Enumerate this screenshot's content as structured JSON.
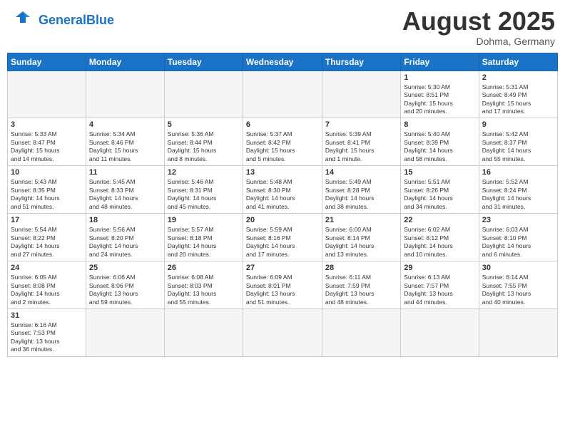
{
  "header": {
    "logo_general": "General",
    "logo_blue": "Blue",
    "month_title": "August 2025",
    "subtitle": "Dohma, Germany"
  },
  "weekdays": [
    "Sunday",
    "Monday",
    "Tuesday",
    "Wednesday",
    "Thursday",
    "Friday",
    "Saturday"
  ],
  "weeks": [
    [
      {
        "day": "",
        "empty": true
      },
      {
        "day": "",
        "empty": true
      },
      {
        "day": "",
        "empty": true
      },
      {
        "day": "",
        "empty": true
      },
      {
        "day": "",
        "empty": true
      },
      {
        "day": "1",
        "lines": [
          "Sunrise: 5:30 AM",
          "Sunset: 8:51 PM",
          "Daylight: 15 hours",
          "and 20 minutes."
        ]
      },
      {
        "day": "2",
        "lines": [
          "Sunrise: 5:31 AM",
          "Sunset: 8:49 PM",
          "Daylight: 15 hours",
          "and 17 minutes."
        ]
      }
    ],
    [
      {
        "day": "3",
        "lines": [
          "Sunrise: 5:33 AM",
          "Sunset: 8:47 PM",
          "Daylight: 15 hours",
          "and 14 minutes."
        ]
      },
      {
        "day": "4",
        "lines": [
          "Sunrise: 5:34 AM",
          "Sunset: 8:46 PM",
          "Daylight: 15 hours",
          "and 11 minutes."
        ]
      },
      {
        "day": "5",
        "lines": [
          "Sunrise: 5:36 AM",
          "Sunset: 8:44 PM",
          "Daylight: 15 hours",
          "and 8 minutes."
        ]
      },
      {
        "day": "6",
        "lines": [
          "Sunrise: 5:37 AM",
          "Sunset: 8:42 PM",
          "Daylight: 15 hours",
          "and 5 minutes."
        ]
      },
      {
        "day": "7",
        "lines": [
          "Sunrise: 5:39 AM",
          "Sunset: 8:41 PM",
          "Daylight: 15 hours",
          "and 1 minute."
        ]
      },
      {
        "day": "8",
        "lines": [
          "Sunrise: 5:40 AM",
          "Sunset: 8:39 PM",
          "Daylight: 14 hours",
          "and 58 minutes."
        ]
      },
      {
        "day": "9",
        "lines": [
          "Sunrise: 5:42 AM",
          "Sunset: 8:37 PM",
          "Daylight: 14 hours",
          "and 55 minutes."
        ]
      }
    ],
    [
      {
        "day": "10",
        "lines": [
          "Sunrise: 5:43 AM",
          "Sunset: 8:35 PM",
          "Daylight: 14 hours",
          "and 51 minutes."
        ]
      },
      {
        "day": "11",
        "lines": [
          "Sunrise: 5:45 AM",
          "Sunset: 8:33 PM",
          "Daylight: 14 hours",
          "and 48 minutes."
        ]
      },
      {
        "day": "12",
        "lines": [
          "Sunrise: 5:46 AM",
          "Sunset: 8:31 PM",
          "Daylight: 14 hours",
          "and 45 minutes."
        ]
      },
      {
        "day": "13",
        "lines": [
          "Sunrise: 5:48 AM",
          "Sunset: 8:30 PM",
          "Daylight: 14 hours",
          "and 41 minutes."
        ]
      },
      {
        "day": "14",
        "lines": [
          "Sunrise: 5:49 AM",
          "Sunset: 8:28 PM",
          "Daylight: 14 hours",
          "and 38 minutes."
        ]
      },
      {
        "day": "15",
        "lines": [
          "Sunrise: 5:51 AM",
          "Sunset: 8:26 PM",
          "Daylight: 14 hours",
          "and 34 minutes."
        ]
      },
      {
        "day": "16",
        "lines": [
          "Sunrise: 5:52 AM",
          "Sunset: 8:24 PM",
          "Daylight: 14 hours",
          "and 31 minutes."
        ]
      }
    ],
    [
      {
        "day": "17",
        "lines": [
          "Sunrise: 5:54 AM",
          "Sunset: 8:22 PM",
          "Daylight: 14 hours",
          "and 27 minutes."
        ]
      },
      {
        "day": "18",
        "lines": [
          "Sunrise: 5:56 AM",
          "Sunset: 8:20 PM",
          "Daylight: 14 hours",
          "and 24 minutes."
        ]
      },
      {
        "day": "19",
        "lines": [
          "Sunrise: 5:57 AM",
          "Sunset: 8:18 PM",
          "Daylight: 14 hours",
          "and 20 minutes."
        ]
      },
      {
        "day": "20",
        "lines": [
          "Sunrise: 5:59 AM",
          "Sunset: 8:16 PM",
          "Daylight: 14 hours",
          "and 17 minutes."
        ]
      },
      {
        "day": "21",
        "lines": [
          "Sunrise: 6:00 AM",
          "Sunset: 8:14 PM",
          "Daylight: 14 hours",
          "and 13 minutes."
        ]
      },
      {
        "day": "22",
        "lines": [
          "Sunrise: 6:02 AM",
          "Sunset: 8:12 PM",
          "Daylight: 14 hours",
          "and 10 minutes."
        ]
      },
      {
        "day": "23",
        "lines": [
          "Sunrise: 6:03 AM",
          "Sunset: 8:10 PM",
          "Daylight: 14 hours",
          "and 6 minutes."
        ]
      }
    ],
    [
      {
        "day": "24",
        "lines": [
          "Sunrise: 6:05 AM",
          "Sunset: 8:08 PM",
          "Daylight: 14 hours",
          "and 2 minutes."
        ]
      },
      {
        "day": "25",
        "lines": [
          "Sunrise: 6:06 AM",
          "Sunset: 8:06 PM",
          "Daylight: 13 hours",
          "and 59 minutes."
        ]
      },
      {
        "day": "26",
        "lines": [
          "Sunrise: 6:08 AM",
          "Sunset: 8:03 PM",
          "Daylight: 13 hours",
          "and 55 minutes."
        ]
      },
      {
        "day": "27",
        "lines": [
          "Sunrise: 6:09 AM",
          "Sunset: 8:01 PM",
          "Daylight: 13 hours",
          "and 51 minutes."
        ]
      },
      {
        "day": "28",
        "lines": [
          "Sunrise: 6:11 AM",
          "Sunset: 7:59 PM",
          "Daylight: 13 hours",
          "and 48 minutes."
        ]
      },
      {
        "day": "29",
        "lines": [
          "Sunrise: 6:13 AM",
          "Sunset: 7:57 PM",
          "Daylight: 13 hours",
          "and 44 minutes."
        ]
      },
      {
        "day": "30",
        "lines": [
          "Sunrise: 6:14 AM",
          "Sunset: 7:55 PM",
          "Daylight: 13 hours",
          "and 40 minutes."
        ]
      }
    ],
    [
      {
        "day": "31",
        "lines": [
          "Sunrise: 6:16 AM",
          "Sunset: 7:53 PM",
          "Daylight: 13 hours",
          "and 36 minutes."
        ]
      },
      {
        "day": "",
        "empty": true
      },
      {
        "day": "",
        "empty": true
      },
      {
        "day": "",
        "empty": true
      },
      {
        "day": "",
        "empty": true
      },
      {
        "day": "",
        "empty": true
      },
      {
        "day": "",
        "empty": true
      }
    ]
  ]
}
